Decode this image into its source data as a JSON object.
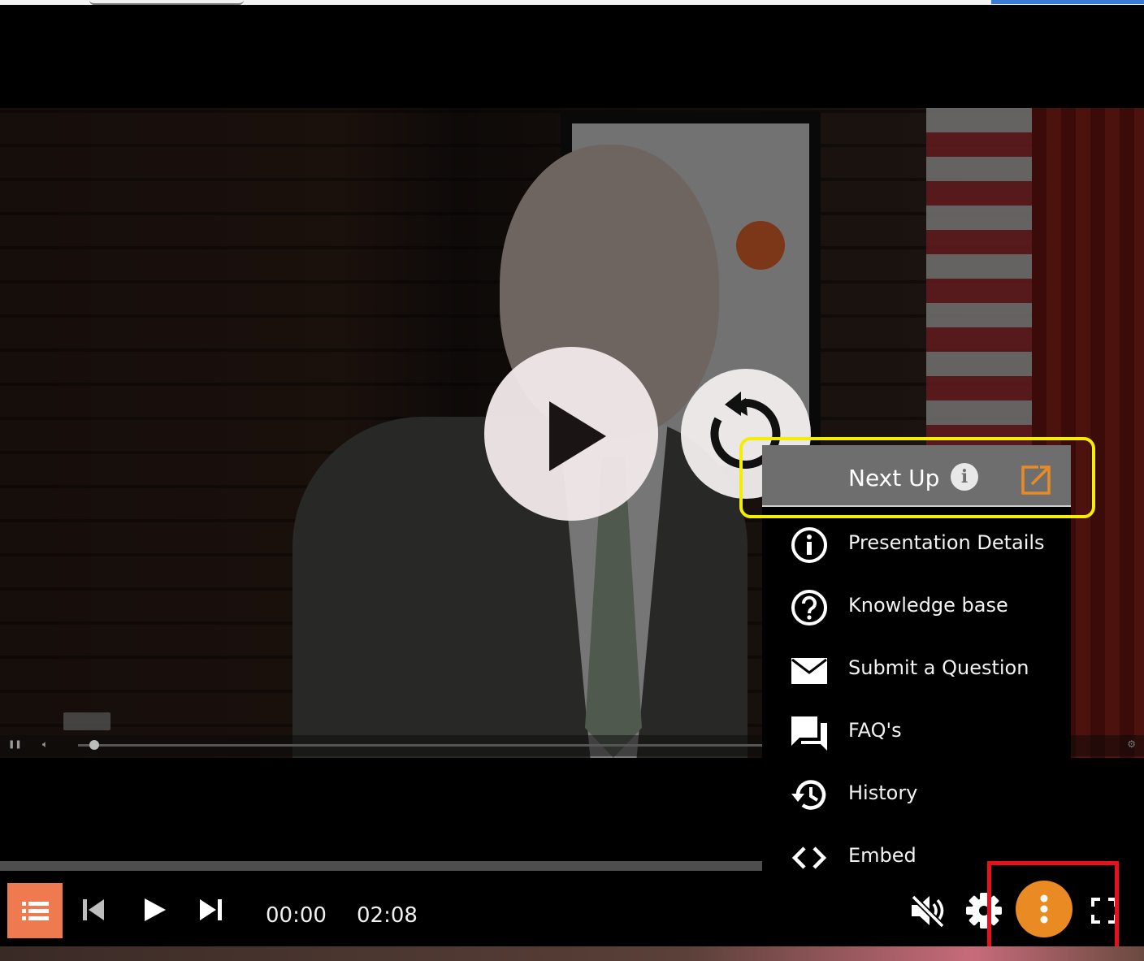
{
  "player": {
    "next_up": {
      "label": "Next Up",
      "info_glyph": "i"
    },
    "menu": {
      "items": [
        {
          "label": "Presentation Details",
          "icon": "info-circle-icon"
        },
        {
          "label": "Knowledge base",
          "icon": "question-circle-icon"
        },
        {
          "label": "Submit a Question",
          "icon": "envelope-icon"
        },
        {
          "label": "FAQ's",
          "icon": "chat-bubbles-icon"
        },
        {
          "label": "History",
          "icon": "history-icon"
        },
        {
          "label": "Embed",
          "icon": "code-brackets-icon"
        }
      ]
    },
    "controls": {
      "current_time": "00:00",
      "duration": "02:08"
    },
    "colors": {
      "accent_orange": "#e98b22",
      "playlist_orange": "#f07a4f",
      "highlight_yellow": "#f4ef00",
      "highlight_red": "#e8101a",
      "menu_header_gray": "#6e6e6e"
    }
  }
}
